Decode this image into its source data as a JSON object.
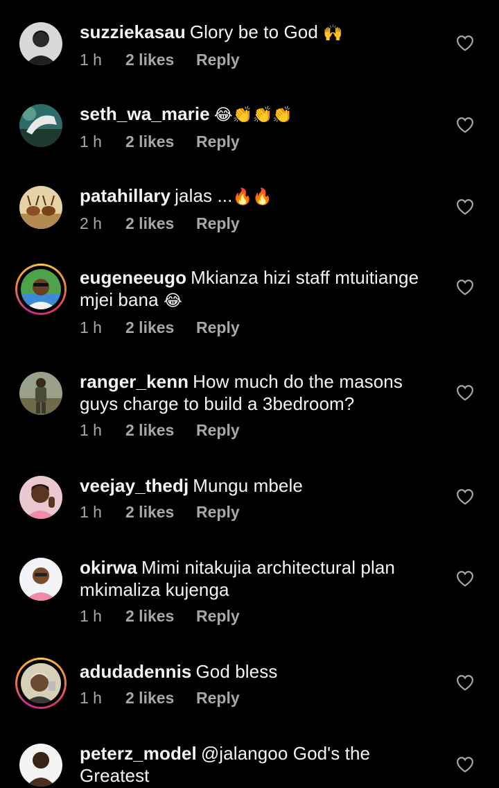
{
  "comments": [
    {
      "username": "suzziekasau",
      "text": "Glory be to God",
      "emoji": "🙌",
      "time": "1 h",
      "likes": "2 likes",
      "reply": "Reply"
    },
    {
      "username": "seth_wa_marie",
      "text": "",
      "emoji": "😂👏👏👏",
      "time": "1 h",
      "likes": "2 likes",
      "reply": "Reply"
    },
    {
      "username": "patahillary",
      "text": "jalas ...",
      "emoji": "🔥🔥",
      "time": "2 h",
      "likes": "2 likes",
      "reply": "Reply"
    },
    {
      "username": "eugeneeugo",
      "text": "Mkianza hizi staff mtuitiange mjei bana",
      "emoji": "😂",
      "time": "1 h",
      "likes": "2 likes",
      "reply": "Reply"
    },
    {
      "username": "ranger_kenn",
      "text": "How much do the masons guys charge to build a 3bedroom?",
      "emoji": "",
      "time": "1 h",
      "likes": "2 likes",
      "reply": "Reply"
    },
    {
      "username": "veejay_thedj",
      "text": "Mungu mbele",
      "emoji": "",
      "time": "1 h",
      "likes": "2 likes",
      "reply": "Reply"
    },
    {
      "username": "okirwa",
      "text": "Mimi nitakujia architectural plan mkimaliza kujenga",
      "emoji": "",
      "time": "1 h",
      "likes": "2 likes",
      "reply": "Reply"
    },
    {
      "username": "adudadennis",
      "text": "God bless",
      "emoji": "",
      "time": "1 h",
      "likes": "2 likes",
      "reply": "Reply"
    },
    {
      "username": "peterz_model",
      "text": "@jalangoo God's the Greatest",
      "emoji": "",
      "time": "",
      "likes": "",
      "reply": ""
    }
  ],
  "icons": {
    "like": "heart-outline-icon"
  },
  "colors": {
    "background": "#000000",
    "text": "#f5f5f5",
    "meta": "#a8a8a8",
    "story_ring_start": "#f9c846",
    "story_ring_end": "#c0308f"
  }
}
